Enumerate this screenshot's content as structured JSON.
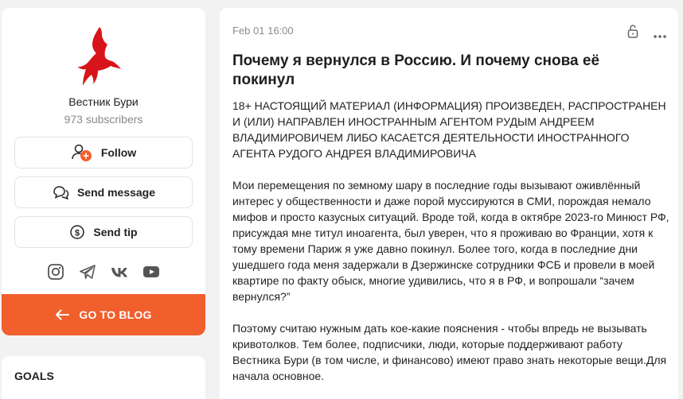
{
  "sidebar": {
    "channel_name": "Вестник Бури",
    "subscribers": "973 subscribers",
    "buttons": {
      "follow": "Follow",
      "message": "Send message",
      "tip": "Send tip"
    },
    "socials": [
      "instagram-icon",
      "telegram-icon",
      "vk-icon",
      "youtube-icon"
    ],
    "go_blog": "GO TO BLOG"
  },
  "goals": {
    "title": "GOALS"
  },
  "post": {
    "date": "Feb 01 16:00",
    "title": "Почему я вернулся в Россию. И почему снова её покинул",
    "paragraphs": [
      "18+ НАСТОЯЩИЙ МАТЕРИАЛ (ИНФОРМАЦИЯ) ПРОИЗВЕДЕН, РАСПРОСТРАНЕН И (ИЛИ) НАПРАВЛЕН ИНОСТРАННЫМ АГЕНТОМ РУДЫМ АНДРЕЕМ ВЛАДИМИРОВИЧЕМ ЛИБО КАСАЕТСЯ ДЕЯТЕЛЬНОСТИ ИНОСТРАННОГО АГЕНТА РУДОГО АНДРЕЯ ВЛАДИМИРОВИЧА",
      "Мои перемещения по земному шару в последние годы вызывают оживлённый интерес у общественности и даже порой муссируются в СМИ, порождая немало мифов и просто казусных ситуаций. Вроде той, когда в октябре 2023-го Минюст РФ, присуждая мне титул иноагента, был уверен, что я проживаю во Франции, хотя к тому времени Париж я уже давно покинул. Более того, когда в последние дни ушедшего года меня задержали в Дзержинске сотрудники ФСБ и провели в моей квартире по факту обыск, многие удивились, что я в РФ, и вопрошали “зачем вернулся?”",
      "Поэтому считаю нужным дать кое-какие пояснения - чтобы впредь не вызывать кривотолков. Тем более, подписчики, люди, которые поддерживают работу Вестника Бури (в том числе, и финансово) имеют право знать некоторые вещи.Для начала основное."
    ]
  },
  "colors": {
    "accent": "#f15f2d",
    "logo_red": "#d8141b",
    "background": "#f2f2f3"
  }
}
